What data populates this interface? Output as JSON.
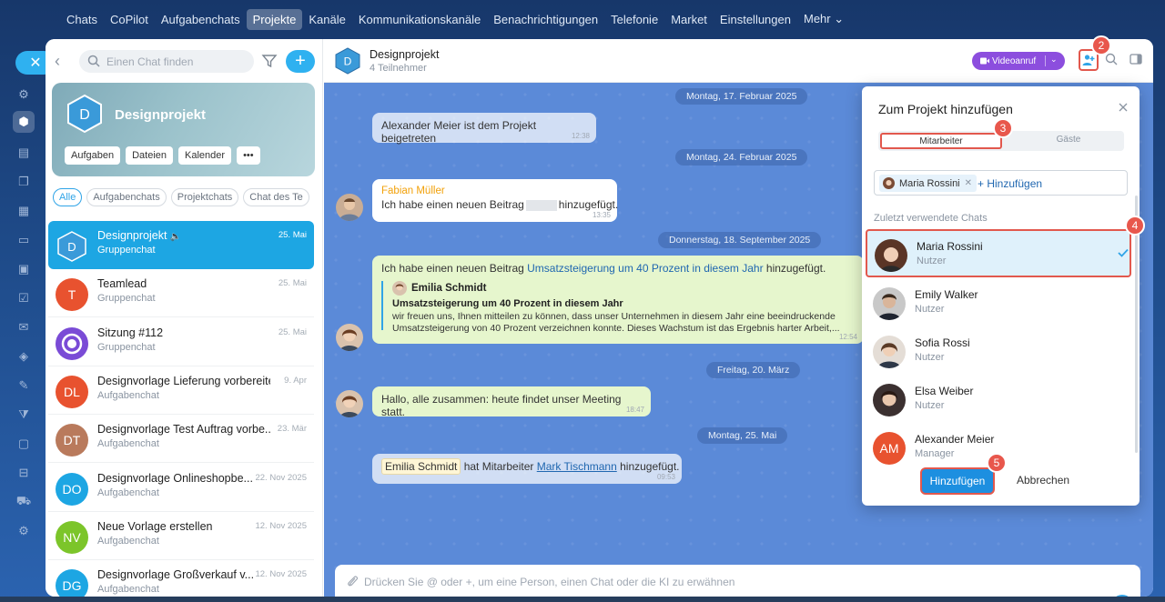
{
  "nav": [
    "Chats",
    "CoPilot",
    "Aufgabenchats",
    "Projekte",
    "Kanäle",
    "Kommunikationskanäle",
    "Benachrichtigungen",
    "Telefonie",
    "Market",
    "Einstellungen",
    "Mehr"
  ],
  "sidebar": {
    "search_placeholder": "Einen Chat finden",
    "project_card": {
      "avatar": "D",
      "title": "Designprojekt",
      "buttons": [
        "Aufgaben",
        "Dateien",
        "Kalender",
        "•••"
      ]
    },
    "tabs": [
      "Alle",
      "Aufgabenchats",
      "Projektchats",
      "Chat des Te"
    ],
    "chats": [
      {
        "avatar": "D",
        "name": "Designprojekt",
        "sub": "Gruppenchat",
        "date": "25. Mai",
        "color": "#1da6e3"
      },
      {
        "avatar": "T",
        "name": "Teamlead",
        "sub": "Gruppenchat",
        "date": "25. Mai",
        "color": "#e8522f"
      },
      {
        "avatar": "",
        "name": "Sitzung #112",
        "sub": "Gruppenchat",
        "date": "25. Mai",
        "color": "#7a4bd6"
      },
      {
        "avatar": "DL",
        "name": "Designvorlage Lieferung vorbereiten",
        "sub": "Aufgabenchat",
        "date": "9. Apr",
        "color": "#e8522f"
      },
      {
        "avatar": "DT",
        "name": "Designvorlage Test Auftrag vorbe...",
        "sub": "Aufgabenchat",
        "date": "23. Mär",
        "color": "#b97a5c"
      },
      {
        "avatar": "DO",
        "name": "Designvorlage Onlineshopbe...",
        "sub": "Aufgabenchat",
        "date": "22. Nov 2025",
        "color": "#1da6e3"
      },
      {
        "avatar": "NV",
        "name": "Neue Vorlage erstellen",
        "sub": "Aufgabenchat",
        "date": "12. Nov 2025",
        "color": "#7cc52a"
      },
      {
        "avatar": "DG",
        "name": "Designvorlage Großverkauf v...",
        "sub": "Aufgabenchat",
        "date": "12. Nov 2025",
        "color": "#1da6e3"
      }
    ]
  },
  "header": {
    "avatar": "D",
    "title": "Designprojekt",
    "subtitle": "4 Teilnehmer",
    "video_label": "Videoanruf"
  },
  "messages": {
    "d1": "Montag, 17. Februar 2025",
    "m1": "Alexander Meier ist dem Projekt beigetreten",
    "m1_time": "12:38",
    "d2": "Montag, 24. Februar 2025",
    "m2_author": "Fabian Müller",
    "m2_text_a": "Ich habe einen neuen Beitrag",
    "m2_text_b": "hinzugefügt.",
    "m2_time": "13:35",
    "d3": "Donnerstag, 18. September 2025",
    "m3_a": "Ich habe einen neuen Beitrag ",
    "m3_link": "Umsatzsteigerung um 40 Prozent in diesem Jahr",
    "m3_b": " hinzugefügt.",
    "m3_q_author": "Emilia Schmidt",
    "m3_q_title": "Umsatzsteigerung um 40 Prozent in diesem Jahr",
    "m3_q_l1": "wir freuen uns, Ihnen mitteilen zu können, dass unser Unternehmen in diesem Jahr eine beeindruckende",
    "m3_q_l2": "Umsatzsteigerung von 40 Prozent verzeichnen konnte. Dieses Wachstum ist das Ergebnis harter Arbeit,...",
    "m3_time": "12:54",
    "d4": "Freitag, 20. März",
    "m4": "Hallo, alle zusammen: heute findet unser Meeting statt.",
    "m4_time": "18:47",
    "d5": "Montag, 25. Mai",
    "m5_name": "Emilia Schmidt",
    "m5_mid": " hat Mitarbeiter ",
    "m5_link": "Mark Tischmann",
    "m5_end": " hinzugefügt.",
    "m5_time": "09:53"
  },
  "composer": {
    "placeholder": "Drücken Sie @ oder +, um eine Person, einen Chat oder die KI zu erwähnen"
  },
  "popup": {
    "title": "Zum Projekt hinzufügen",
    "tab_employees": "Mitarbeiter",
    "tab_guests": "Gäste",
    "selected_tag": "Maria Rossini",
    "add_link": "+ Hinzufügen",
    "recent_label": "Zuletzt verwendete Chats",
    "people": [
      {
        "name": "Maria Rossini",
        "role": "Nutzer"
      },
      {
        "name": "Emily Walker",
        "role": "Nutzer"
      },
      {
        "name": "Sofia Rossi",
        "role": "Nutzer"
      },
      {
        "name": "Elsa Weiber",
        "role": "Nutzer"
      },
      {
        "name": "Alexander Meier",
        "role": "Manager",
        "avatar": "AM"
      }
    ],
    "add_button": "Hinzufügen",
    "cancel_button": "Abbrechen"
  },
  "badges": [
    "2",
    "3",
    "4",
    "5"
  ]
}
